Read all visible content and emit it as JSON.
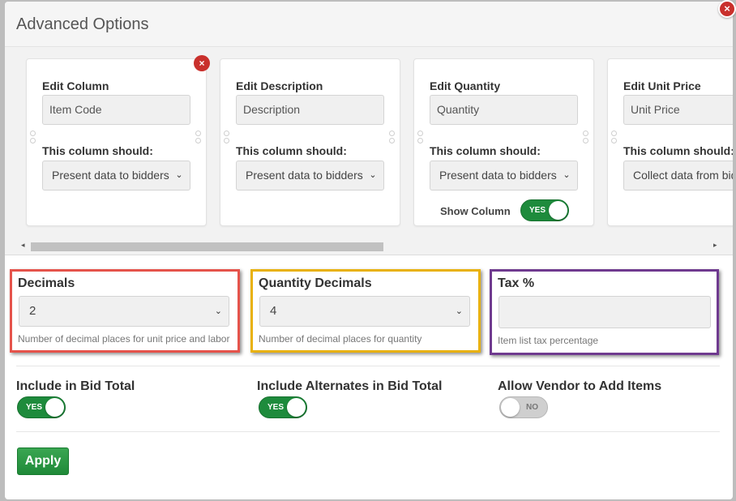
{
  "modal": {
    "title": "Advanced Options",
    "close_symbol": "×"
  },
  "columns": [
    {
      "title": "Edit Column",
      "input_value": "Item Code",
      "should_label": "This column should:",
      "select_value": "Present data to bidders",
      "removable": true
    },
    {
      "title": "Edit Description",
      "input_value": "Description",
      "should_label": "This column should:",
      "select_value": "Present data to bidders"
    },
    {
      "title": "Edit Quantity",
      "input_value": "Quantity",
      "should_label": "This column should:",
      "select_value": "Present data to bidders",
      "show_column_label": "Show Column",
      "show_column_toggle": "YES"
    },
    {
      "title": "Edit Unit Price",
      "input_value": "Unit Price",
      "should_label": "This column should:",
      "select_value": "Collect data from bidders"
    }
  ],
  "remove_symbol": "×",
  "scroll": {
    "left_arrow": "◂",
    "right_arrow": "▸"
  },
  "options": {
    "decimals": {
      "label": "Decimals",
      "value": "2",
      "help": "Number of decimal places for unit price and labor",
      "border_color": "#e5534b"
    },
    "quantity_decimals": {
      "label": "Quantity Decimals",
      "value": "4",
      "help": "Number of decimal places for quantity",
      "border_color": "#e8b10c"
    },
    "tax": {
      "label": "Tax %",
      "value": "",
      "help": "Item list tax percentage",
      "border_color": "#6f3a8f"
    }
  },
  "toggles": {
    "include_in_bid_total": {
      "label": "Include in Bid Total",
      "state": "YES"
    },
    "include_alternates": {
      "label": "Include Alternates in Bid Total",
      "state": "YES"
    },
    "allow_vendor_add": {
      "label": "Allow Vendor to Add Items",
      "state": "NO"
    }
  },
  "apply_label": "Apply",
  "colors": {
    "toggle_on": "#1e8b3c",
    "apply": "#2a9845",
    "danger": "#c9302c"
  }
}
